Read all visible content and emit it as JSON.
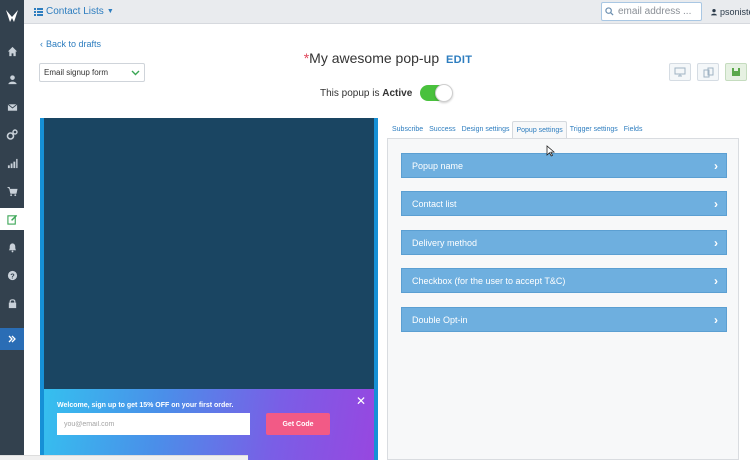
{
  "topbar": {
    "contact_lists_label": "Contact Lists",
    "search_placeholder": "email address ...",
    "username": "psonistegr"
  },
  "sidebar": {
    "items": [
      "home-icon",
      "user-icon",
      "mail-icon",
      "settings-icon",
      "reports-icon",
      "cart-icon",
      "forms-icon",
      "bell-icon",
      "help-icon",
      "lock-icon",
      "expand-icon"
    ],
    "active": "forms-icon"
  },
  "header": {
    "back_label": "Back to drafts",
    "form_type_selected": "Email signup form",
    "title_star": "*",
    "title": "My awesome pop-up",
    "edit_label": "EDIT",
    "status_prefix": "This popup is",
    "status_value": "Active",
    "toggle_on": true
  },
  "preview": {
    "popup_text": "Welcome, sign up to get 15% OFF on your first order.",
    "email_placeholder": "you@email.com",
    "button_label": "Get Code",
    "close_glyph": "✕"
  },
  "tabs": [
    {
      "label": "Subscribe"
    },
    {
      "label": "Success"
    },
    {
      "label": "Design settings"
    },
    {
      "label": "Popup settings",
      "active": true
    },
    {
      "label": "Trigger settings"
    },
    {
      "label": "Fields"
    }
  ],
  "accordion": [
    {
      "label": "Popup name"
    },
    {
      "label": "Contact list"
    },
    {
      "label": "Delivery method"
    },
    {
      "label": "Checkbox (for the user to accept T&C)"
    },
    {
      "label": "Double Opt-in"
    }
  ],
  "colors": {
    "sidebar": "#33414e",
    "accent": "#2d7dbf",
    "accordion": "#6eafdf",
    "toggle_on": "#49c13d",
    "cta": "#f25a86"
  }
}
